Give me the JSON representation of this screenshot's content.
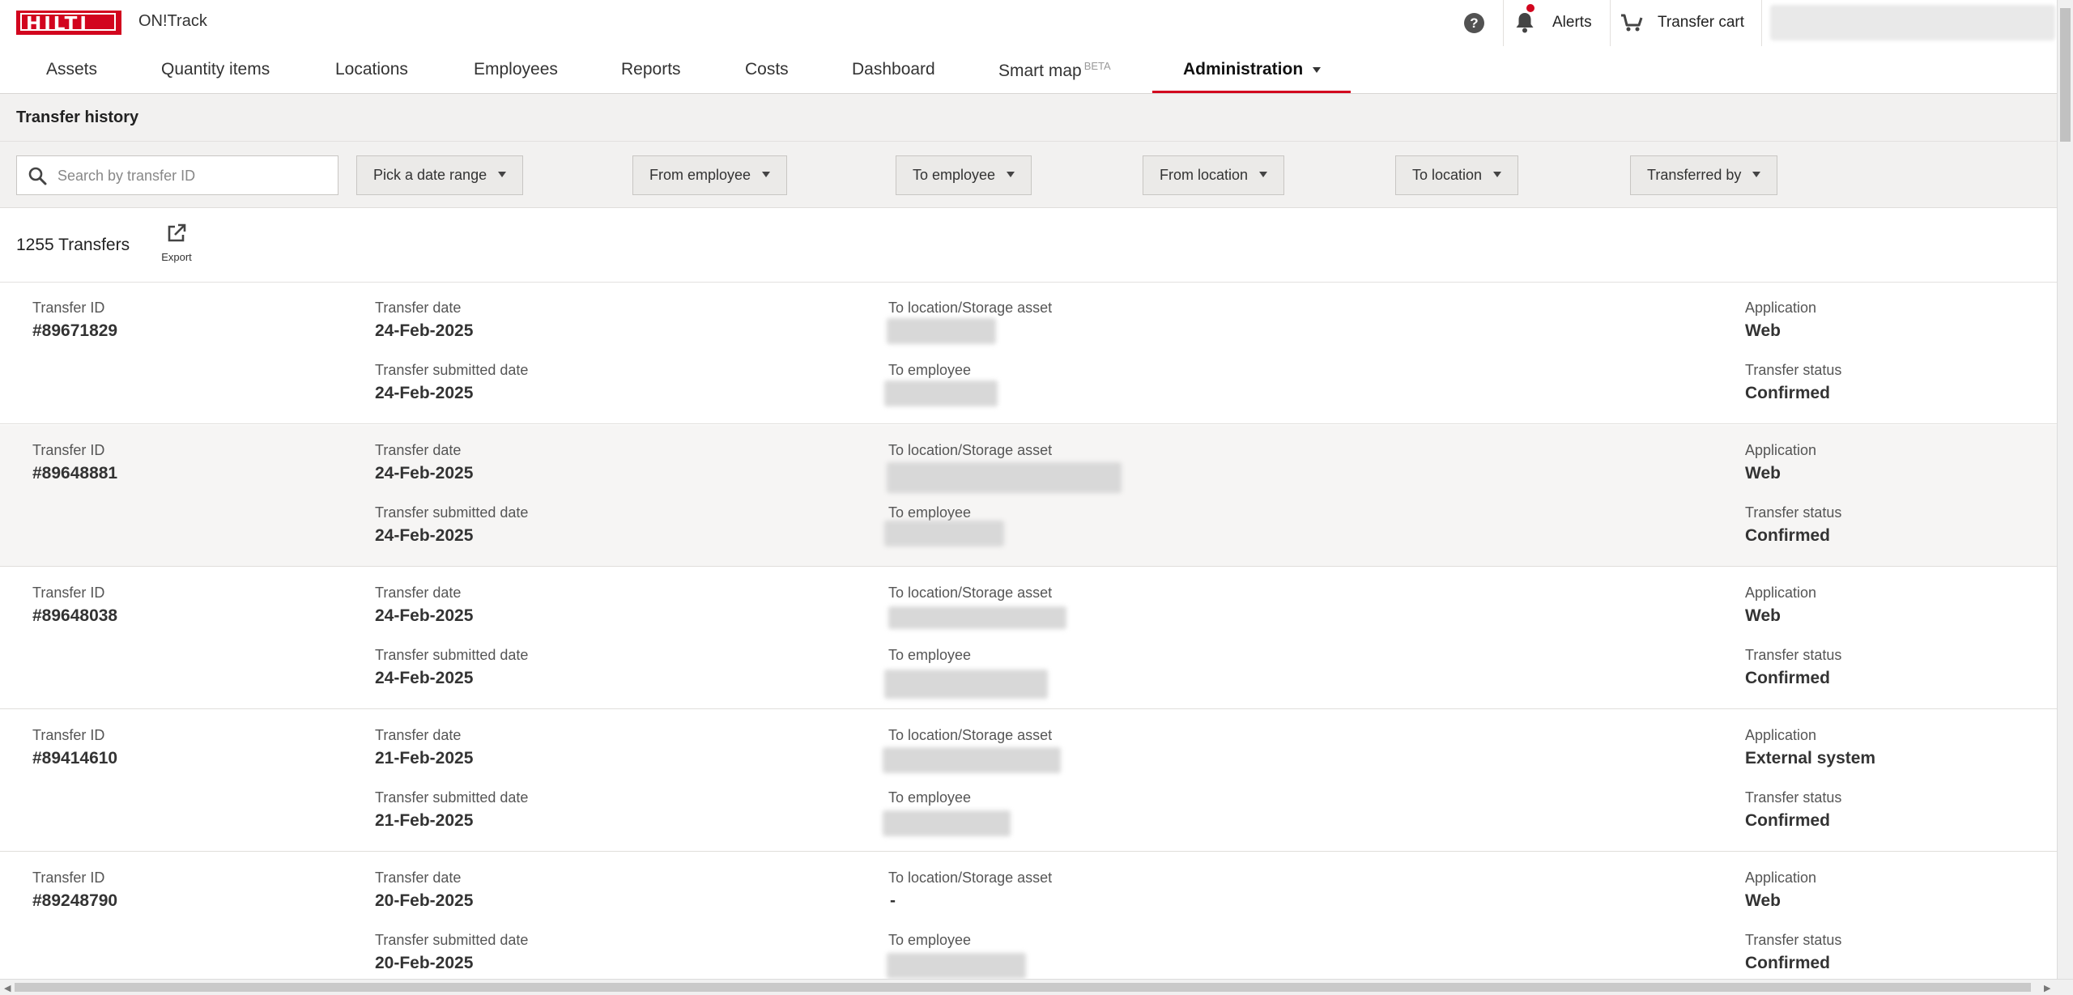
{
  "header": {
    "logo_text": "HILTI",
    "app_title": "ON!Track",
    "help_symbol": "?",
    "alerts_label": "Alerts",
    "cart_label": "Transfer cart"
  },
  "nav": {
    "items": [
      {
        "label": "Assets"
      },
      {
        "label": "Quantity items"
      },
      {
        "label": "Locations"
      },
      {
        "label": "Employees"
      },
      {
        "label": "Reports"
      },
      {
        "label": "Costs"
      },
      {
        "label": "Dashboard"
      },
      {
        "label": "Smart map",
        "badge": "BETA"
      },
      {
        "label": "Administration"
      }
    ],
    "active": "Administration"
  },
  "page": {
    "title": "Transfer history",
    "search_placeholder": "Search by transfer ID",
    "filters": [
      "Pick a date range",
      "From employee",
      "To employee",
      "From location",
      "To location",
      "Transferred by"
    ],
    "count": "1255 Transfers",
    "export_label": "Export"
  },
  "labels": {
    "transfer_id": "Transfer ID",
    "transfer_date": "Transfer date",
    "submitted_date": "Transfer submitted date",
    "to_location": "To location/Storage asset",
    "to_employee": "To employee",
    "application": "Application",
    "status": "Transfer status"
  },
  "transfers": [
    {
      "id": "#89671829",
      "date": "24-Feb-2025",
      "submitted": "24-Feb-2025",
      "to_location": "",
      "application": "Web",
      "status": "Confirmed"
    },
    {
      "id": "#89648881",
      "date": "24-Feb-2025",
      "submitted": "24-Feb-2025",
      "to_location": "",
      "application": "Web",
      "status": "Confirmed"
    },
    {
      "id": "#89648038",
      "date": "24-Feb-2025",
      "submitted": "24-Feb-2025",
      "to_location": "",
      "application": "Web",
      "status": "Confirmed"
    },
    {
      "id": "#89414610",
      "date": "21-Feb-2025",
      "submitted": "21-Feb-2025",
      "to_location": "",
      "application": "External system",
      "status": "Confirmed"
    },
    {
      "id": "#89248790",
      "date": "20-Feb-2025",
      "submitted": "20-Feb-2025",
      "to_location": "-",
      "application": "Web",
      "status": "Confirmed"
    }
  ],
  "colors": {
    "brand": "#d2051e",
    "active_underline": "#d2051e"
  }
}
